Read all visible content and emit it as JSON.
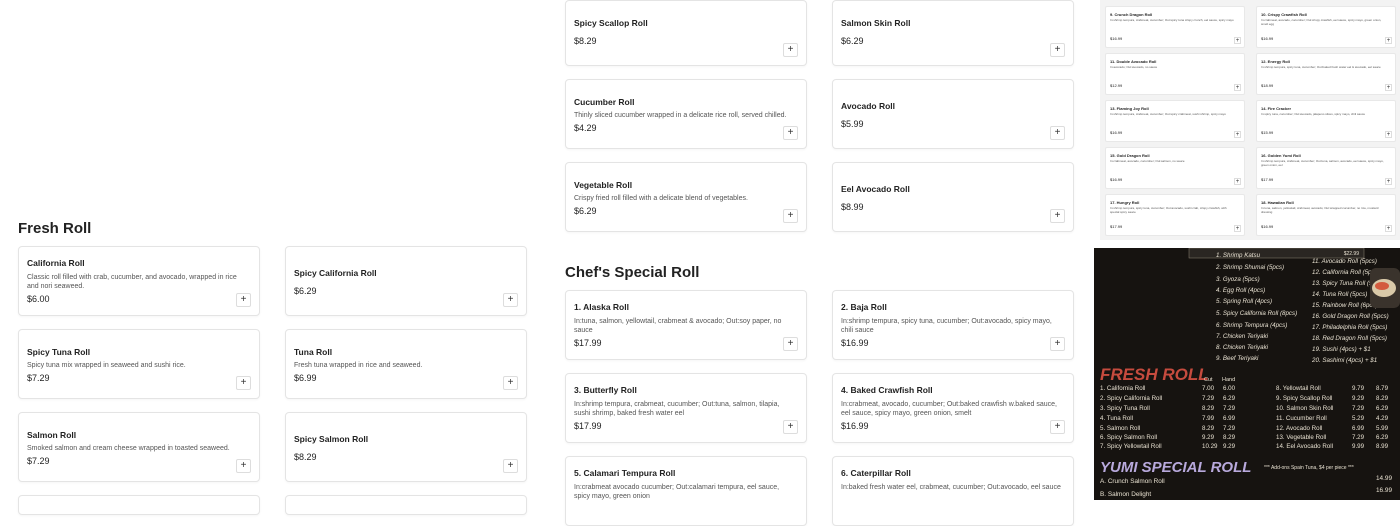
{
  "top_column_1": [
    {
      "name": "Spicy Scallop Roll",
      "description": "",
      "price": "$8.29"
    },
    {
      "name": "Cucumber Roll",
      "description": "Thinly sliced cucumber wrapped in a delicate rice roll, served chilled.",
      "price": "$4.29"
    },
    {
      "name": "Vegetable Roll",
      "description": "Crispy fried roll filled with a delicate blend of vegetables.",
      "price": "$6.29"
    }
  ],
  "top_column_2": [
    {
      "name": "Salmon Skin Roll",
      "description": "",
      "price": "$6.29"
    },
    {
      "name": "Avocado Roll",
      "description": "",
      "price": "$5.99"
    },
    {
      "name": "Eel Avocado Roll",
      "description": "",
      "price": "$8.99"
    }
  ],
  "fresh_roll": {
    "title": "Fresh Roll",
    "items": [
      {
        "name": "California Roll",
        "description": "Classic roll filled with crab, cucumber, and avocado, wrapped in rice and nori seaweed.",
        "price": "$6.00"
      },
      {
        "name": "Spicy California Roll",
        "description": "",
        "price": "$6.29"
      },
      {
        "name": "Spicy Tuna Roll",
        "description": "Spicy tuna mix wrapped in seaweed and sushi rice.",
        "price": "$7.29"
      },
      {
        "name": "Tuna Roll",
        "description": "Fresh tuna wrapped in rice and seaweed.",
        "price": "$6.99"
      },
      {
        "name": "Salmon Roll",
        "description": "Smoked salmon and cream cheese wrapped in toasted seaweed.",
        "price": "$7.29"
      },
      {
        "name": "Spicy Salmon Roll",
        "description": "",
        "price": "$8.29"
      }
    ]
  },
  "chefs_special": {
    "title": "Chef's Special Roll",
    "items": [
      {
        "name": "1. Alaska Roll",
        "description": "In:tuna, salmon, yellowtail, crabmeat & avocado; Out:soy paper, no sauce",
        "price": "$17.99"
      },
      {
        "name": "2. Baja Roll",
        "description": "In:shrimp tempura, spicy tuna, cucumber; Out:avocado, spicy mayo, chili sauce",
        "price": "$16.99"
      },
      {
        "name": "3. Butterfly Roll",
        "description": "In:shrimp tempura, crabmeat, cucumber; Out:tuna, salmon, tilapia, sushi shrimp, baked fresh water eel",
        "price": "$17.99"
      },
      {
        "name": "4. Baked Crawfish Roll",
        "description": "In:crabmeat, avocado, cucumber; Out:baked crawfish w.baked sauce, eel sauce, spicy mayo, green onion, smelt",
        "price": "$16.99"
      },
      {
        "name": "5. Calamari Tempura Roll",
        "description": "In:crabmeat avocado cucumber; Out:calamari tempura, eel sauce, spicy mayo, green onion",
        "price": ""
      },
      {
        "name": "6. Caterpillar Roll",
        "description": "In:baked fresh water eel, crabmeat, cucumber; Out:avocado, eel sauce",
        "price": ""
      }
    ]
  },
  "add_symbol": "+",
  "sheet_items": [
    {
      "name": "9. Crunch Dragon Roll",
      "description": "In:shrimp tempura, crabmeat, cucumber; Out:spicy tuna crispy crunch, eel sauce, spicy mayo",
      "price": "$16.99"
    },
    {
      "name": "10. Crispy Crawfish Roll",
      "description": "In:crabmeat, avocado, cucumber; Out:crispy crawfish, eel sauce, spicy mayo, green onion, smelt egg",
      "price": "$16.99"
    },
    {
      "name": "11. Double Avocado Roll",
      "description": "In:avocado; Out:avocado, no sauce",
      "price": "$12.99"
    },
    {
      "name": "12. Energy Roll",
      "description": "In:shrimp tempura, spicy tuna, cucumber; Out:baked fresh water eel & avocado, eel sauce",
      "price": "$18.99"
    },
    {
      "name": "13. Flaming Joy Roll",
      "description": "In:shrimp tempura, crabmeat, cucumber; Out:spicy crabmeat, sushi shrimp, spicy mayo",
      "price": "$16.99"
    },
    {
      "name": "14. Fire Cracker",
      "description": "In:spicy tuna, cucumber; Out:avocado, jalapeno slices, spicy mayo, chili sauce",
      "price": "$15.99"
    },
    {
      "name": "15. Gold Dragon Roll",
      "description": "In:crabmeat, avocado, cucumber; Out:salmon, no sauce",
      "price": "$16.99"
    },
    {
      "name": "16. Golden Yumi Roll",
      "description": "In:shrimp tempura, crabmeat, cucumber; Out:tuna, salmon, avocado, eel sauce, spicy mayo, green onion, eel",
      "price": "$17.99"
    },
    {
      "name": "17. Hungry Roll",
      "description": "In:shrimp tempura, spicy tuna, cucumber; Out:avocado, sushi crab, crispy crawfish, with special spicy sauce",
      "price": "$17.99"
    },
    {
      "name": "18. Hawaiian Roll",
      "description": "In:tuna, salmon, yellowtail, crabmeat, avocado; Out:wrapped cucumber, no rice, mustard dressing",
      "price": "$16.99"
    }
  ],
  "photo": {
    "left_list": [
      "1. Shrimp Katsu",
      "2. Shrimp Shumai (5pcs)",
      "3. Gyoza (5pcs)",
      "4. Egg Roll (4pcs)",
      "5. Spring Roll (4pcs)",
      "5. Spicy California Roll (8pcs)",
      "6. Shrimp Tempura (4pcs)",
      "7. Chicken Teriyaki",
      "8. Chicken Teriyaki",
      "9. Beef Teriyaki"
    ],
    "right_list": [
      "11. Avocado Roll (5pcs)",
      "12. California Roll (5pcs)",
      "13. Spicy Tuna Roll (5pcs)",
      "14. Tuna Roll (5pcs)",
      "15. Rainbow Roll (6pcs)",
      "16. Gold Dragon Roll (5pcs)",
      "17. Philadelphia Roll (5pcs)",
      "18. Red Dragon Roll (5pcs)",
      "19. Sushi (4pcs) + $1",
      "20. Sashimi (4pcs) + $1"
    ],
    "top_price": "$22.99",
    "fresh_title": "FRESH ROLL",
    "col_cut": "Cut",
    "col_hand": "Hand",
    "fresh_left": [
      {
        "name": "1. California Roll",
        "cut": "7.00",
        "hand": "6.00"
      },
      {
        "name": "2. Spicy California Roll",
        "cut": "7.29",
        "hand": "6.29"
      },
      {
        "name": "3. Spicy Tuna Roll",
        "cut": "8.29",
        "hand": "7.29"
      },
      {
        "name": "4. Tuna Roll",
        "cut": "7.99",
        "hand": "6.99"
      },
      {
        "name": "5. Salmon Roll",
        "cut": "8.29",
        "hand": "7.29"
      },
      {
        "name": "6. Spicy Salmon Roll",
        "cut": "9.29",
        "hand": "8.29"
      },
      {
        "name": "7. Spicy Yellowtail Roll",
        "cut": "10.29",
        "hand": "9.29"
      }
    ],
    "fresh_right": [
      {
        "name": "8. Yellowtail Roll",
        "cut": "9.79",
        "hand": "8.79"
      },
      {
        "name": "9. Spicy Scallop Roll",
        "cut": "9.29",
        "hand": "8.29"
      },
      {
        "name": "10. Salmon Skin Roll",
        "cut": "7.29",
        "hand": "6.29"
      },
      {
        "name": "11. Cucumber Roll",
        "cut": "5.29",
        "hand": "4.29"
      },
      {
        "name": "12. Avocado Roll",
        "cut": "6.99",
        "hand": "5.99"
      },
      {
        "name": "13. Vegetable Roll",
        "cut": "7.29",
        "hand": "6.29"
      },
      {
        "name": "14. Eel Avocado Roll",
        "cut": "9.99",
        "hand": "8.99"
      }
    ],
    "yumi_title": "YUMI SPECIAL ROLL",
    "yumi_note": "*** Add-ons Spain Tuna, $4 per piece ***",
    "yumi_items": [
      {
        "name": "A. Crunch Salmon Roll",
        "price": "14.99"
      },
      {
        "name": "B. Salmon Delight",
        "price": "16.99"
      }
    ],
    "colors": {
      "board": "#161310",
      "fresh_title": "#c64b3e",
      "yumi_title": "#b8a9dc",
      "text": "#e9e2d2",
      "ingredients": "#b7aec9"
    }
  }
}
